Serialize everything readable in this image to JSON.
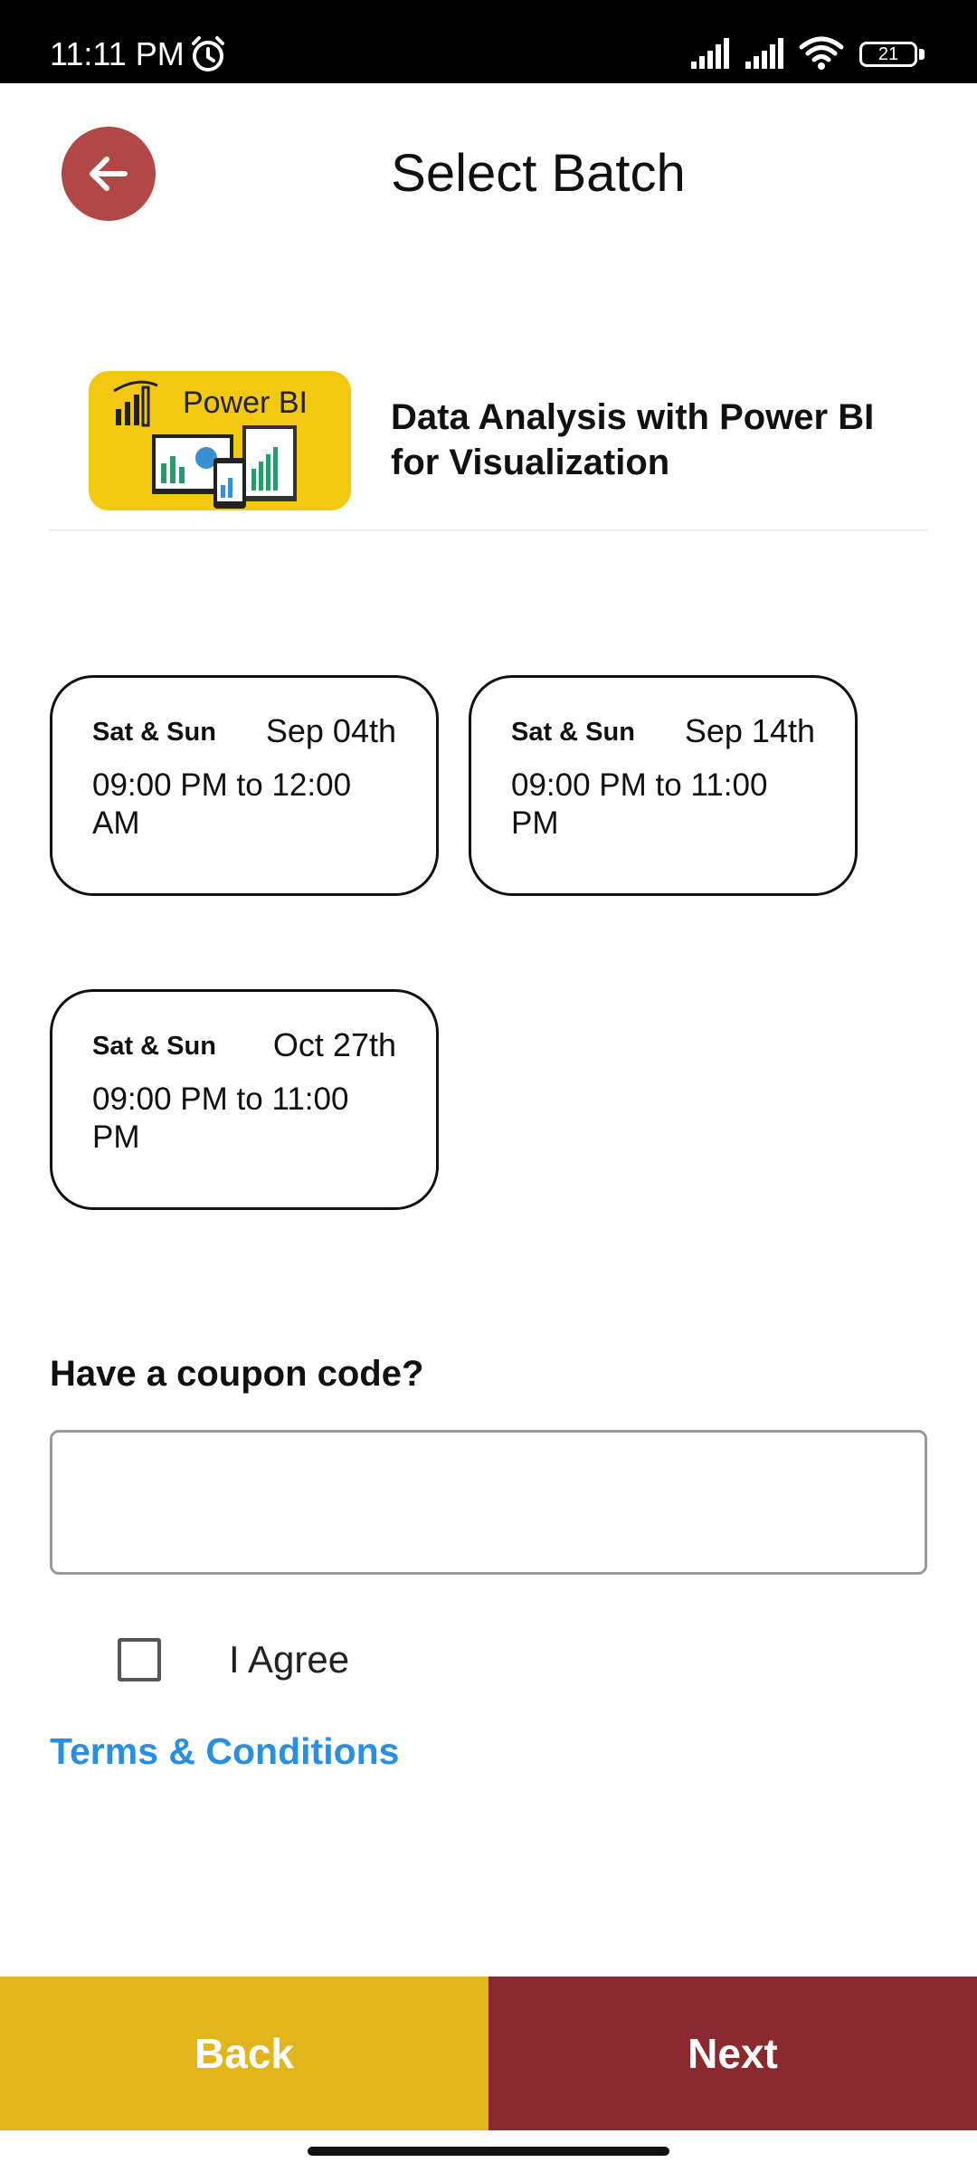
{
  "status_bar": {
    "time": "11:11 PM",
    "battery": "21",
    "icons": [
      "alarm-icon",
      "signal-icon",
      "signal-icon",
      "wifi-icon",
      "battery-icon"
    ]
  },
  "header": {
    "title": "Select Batch",
    "back_icon": "arrow-left-icon"
  },
  "course": {
    "logo_text": "Power BI",
    "title": "Data Analysis with Power BI for Visualization"
  },
  "batches": [
    {
      "days": "Sat & Sun",
      "date": "Sep 04th",
      "time": "09:00 PM to 12:00 AM"
    },
    {
      "days": "Sat & Sun",
      "date": "Sep 14th",
      "time": "09:00 PM to 11:00 PM"
    },
    {
      "days": "Sat & Sun",
      "date": "Oct 27th",
      "time": "09:00 PM to 11:00 PM"
    }
  ],
  "coupon": {
    "label": "Have a coupon code?",
    "value": "",
    "placeholder": ""
  },
  "agree": {
    "label": "I Agree",
    "checked": false
  },
  "terms": {
    "label": "Terms & Conditions"
  },
  "buttons": {
    "back": "Back",
    "next": "Next"
  },
  "colors": {
    "back_circle": "#b24747",
    "back_button": "#e1b61b",
    "next_button": "#8a2a2e",
    "link": "#2a8fe0",
    "logo_bg": "#f2c811"
  }
}
